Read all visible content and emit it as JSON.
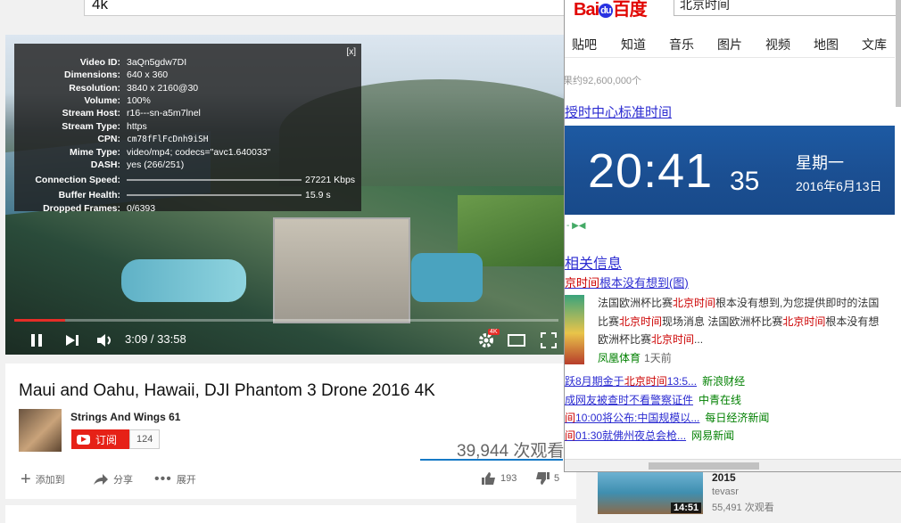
{
  "youtube": {
    "search_value": "4k",
    "stats": {
      "rows": [
        {
          "k": "Video ID:",
          "v": "3aQn5gdw7DI"
        },
        {
          "k": "Dimensions:",
          "v": "640 x 360"
        },
        {
          "k": "Resolution:",
          "v": "3840 x 2160@30"
        },
        {
          "k": "Volume:",
          "v": "100%"
        },
        {
          "k": "Stream Host:",
          "v": "r16---sn-a5m7lnel"
        },
        {
          "k": "Stream Type:",
          "v": "https"
        },
        {
          "k": "CPN:",
          "v": "cm78fFlFcDnh9iSH"
        },
        {
          "k": "Mime Type:",
          "v": "video/mp4; codecs=\"avc1.640033\""
        },
        {
          "k": "DASH:",
          "v": "yes (266/251)"
        }
      ],
      "connection_label": "Connection Speed:",
      "connection_value": "27221 Kbps",
      "buffer_label": "Buffer Health:",
      "buffer_value": "15.9 s",
      "dropped_label": "Dropped Frames:",
      "dropped_value": "0/6393",
      "close": "[x]"
    },
    "player": {
      "time": "3:09 / 33:58",
      "progress_fraction": 0.094,
      "quality_badge": "4K"
    },
    "video": {
      "title": "Maui and Oahu, Hawaii, DJI Phantom 3 Drone 2016 4K",
      "channel": "Strings And Wings 61",
      "subscribe": "订阅",
      "sub_count": "124",
      "views": "39,944 次观看",
      "add_to": "添加到",
      "share": "分享",
      "more": "展开",
      "likes": "193",
      "dislikes": "5"
    },
    "related": {
      "year": "2015",
      "channel": "tevasr",
      "views": "55,491 次观看",
      "duration": "14:51"
    }
  },
  "baidu": {
    "logo_left": "Bai",
    "logo_du": "du",
    "logo_right": "百度",
    "search_value": "北京时间",
    "tabs": [
      "贴吧",
      "知道",
      "音乐",
      "图片",
      "视频",
      "地图",
      "文库"
    ],
    "result_count": "果约92,600,000个",
    "result1": "授时中心标准时间",
    "clock": {
      "hm": "20:41",
      "sec": "35",
      "weekday": "星期一",
      "date": "2016年6月13日"
    },
    "small_text": "-  ▶◀",
    "related_title": "相关信息",
    "news_title_red": "京时间",
    "news_title_rest": "根本没有想到(图)",
    "snippet1_a": "法国欧洲杯比赛",
    "snippet1_red": "北京时间",
    "snippet1_b": "根本没有想到,为您提供即时的法国",
    "snippet2_a": "比赛",
    "snippet2_red": "北京时间",
    "snippet2_b": "现场消息 法国欧洲杯比赛",
    "snippet2_red2": "北京时间",
    "snippet2_c": "根本没有想",
    "snippet3_a": "欧洲杯比赛",
    "snippet3_red": "北京时间",
    "snippet3_b": "...",
    "source1": "凤凰体育",
    "source1_time": "1天前",
    "news": [
      {
        "a": "跃8月期金于",
        "red": "北京时间",
        "b": "13:5...",
        "src": "新浪财经"
      },
      {
        "a": "成网友被查时不看警察证件",
        "red": "",
        "b": "",
        "src": "中青在线"
      },
      {
        "a": "",
        "red": "间",
        "b": "10:00将公布:中国规模以...",
        "src": "每日经济新闻"
      },
      {
        "a": "",
        "red": "间",
        "b": "01:30就佛州夜总会枪...",
        "src": "网易新闻"
      }
    ]
  }
}
